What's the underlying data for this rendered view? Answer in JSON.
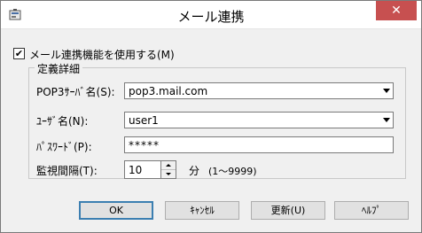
{
  "window": {
    "title": "メール連携",
    "close_glyph": "✕",
    "icon": "app-icon"
  },
  "options": {
    "enable_checkbox": {
      "label": "メール連携機能を使用する(M)",
      "checked": true,
      "check_glyph": "✔"
    }
  },
  "details": {
    "group_title": "定義詳細",
    "pop3_server": {
      "label": "POP3ｻｰﾊﾞ名(S):",
      "value": "pop3.mail.com"
    },
    "user_name": {
      "label": "ﾕｰｻﾞ名(N):",
      "value": "user1"
    },
    "password": {
      "label": "ﾊﾟｽﾜｰﾄﾞ(P):",
      "value": "*****"
    },
    "interval": {
      "label": "監視間隔(T):",
      "value": "10",
      "unit": "分",
      "range": "(1〜9999)"
    }
  },
  "buttons": {
    "ok": "OK",
    "cancel": "ｷｬﾝｾﾙ",
    "update": "更新(U)",
    "help": "ﾍﾙﾌﾟ"
  },
  "colors": {
    "close_button": "#c75050",
    "default_button_border": "#3c7fb1",
    "dialog_background": "#f0f0f0"
  }
}
